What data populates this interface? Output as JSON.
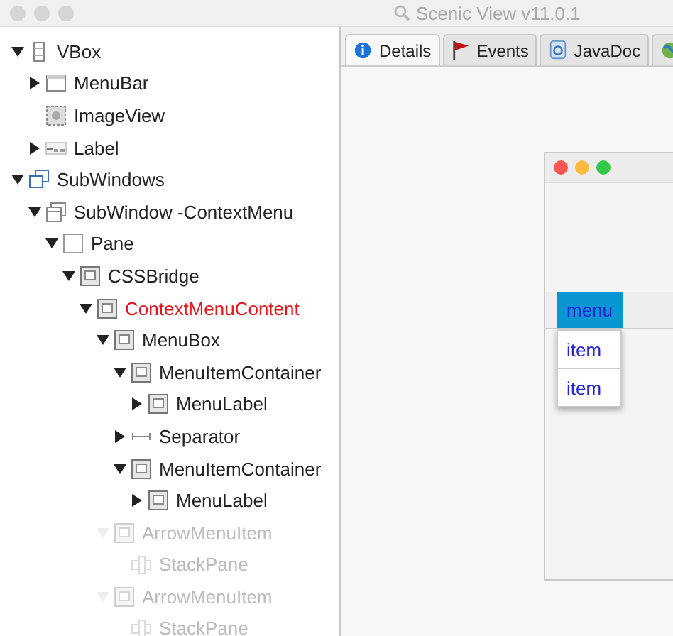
{
  "window": {
    "title": "Scenic View v11.0.1"
  },
  "tree": [
    {
      "label": "VBox",
      "kind": "vbox",
      "expanded": true,
      "selected": false,
      "disabled": false,
      "children": [
        {
          "label": "MenuBar",
          "kind": "menubar",
          "expanded": false,
          "selected": false,
          "disabled": false
        },
        {
          "label": "ImageView",
          "kind": "imageview",
          "selected": false,
          "disabled": false
        },
        {
          "label": "Label",
          "kind": "label",
          "expanded": false,
          "selected": false,
          "disabled": false
        }
      ]
    },
    {
      "label": "SubWindows",
      "kind": "subwindows",
      "expanded": true,
      "selected": false,
      "disabled": false,
      "children": [
        {
          "label": "SubWindow -ContextMenu",
          "kind": "subwindow",
          "expanded": true,
          "selected": false,
          "disabled": false,
          "children": [
            {
              "label": "Pane",
              "kind": "pane",
              "expanded": true,
              "selected": false,
              "disabled": false,
              "children": [
                {
                  "label": "CSSBridge",
                  "kind": "node",
                  "expanded": true,
                  "selected": false,
                  "disabled": false,
                  "children": [
                    {
                      "label": "ContextMenuContent",
                      "kind": "node",
                      "expanded": true,
                      "selected": true,
                      "disabled": false,
                      "children": [
                        {
                          "label": "MenuBox",
                          "kind": "node",
                          "expanded": true,
                          "selected": false,
                          "disabled": false,
                          "children": [
                            {
                              "label": "MenuItemContainer",
                              "kind": "node",
                              "expanded": true,
                              "selected": false,
                              "disabled": false,
                              "children": [
                                {
                                  "label": "MenuLabel",
                                  "kind": "node",
                                  "expanded": false,
                                  "selected": false,
                                  "disabled": false
                                }
                              ]
                            },
                            {
                              "label": "Separator",
                              "kind": "separator",
                              "expanded": false,
                              "selected": false,
                              "disabled": false
                            },
                            {
                              "label": "MenuItemContainer",
                              "kind": "node",
                              "expanded": true,
                              "selected": false,
                              "disabled": false,
                              "children": [
                                {
                                  "label": "MenuLabel",
                                  "kind": "node",
                                  "expanded": false,
                                  "selected": false,
                                  "disabled": false
                                }
                              ]
                            }
                          ]
                        },
                        {
                          "label": "ArrowMenuItem",
                          "kind": "node",
                          "expanded": true,
                          "selected": false,
                          "disabled": true,
                          "children": [
                            {
                              "label": "StackPane",
                              "kind": "stackpane",
                              "selected": false,
                              "disabled": true
                            }
                          ]
                        },
                        {
                          "label": "ArrowMenuItem",
                          "kind": "node",
                          "expanded": true,
                          "selected": false,
                          "disabled": true,
                          "children": [
                            {
                              "label": "StackPane",
                              "kind": "stackpane",
                              "selected": false,
                              "disabled": true
                            }
                          ]
                        }
                      ]
                    }
                  ]
                }
              ]
            }
          ]
        }
      ]
    }
  ],
  "tabs": [
    {
      "label": "Details",
      "kind": "info",
      "selected": true
    },
    {
      "label": "Events",
      "kind": "flag",
      "selected": false
    },
    {
      "label": "JavaDoc",
      "kind": "doc",
      "selected": false
    }
  ],
  "preview": {
    "menu": {
      "label": "menu",
      "selected": true
    },
    "items": [
      {
        "label": "item"
      },
      {
        "label": "item"
      }
    ]
  }
}
